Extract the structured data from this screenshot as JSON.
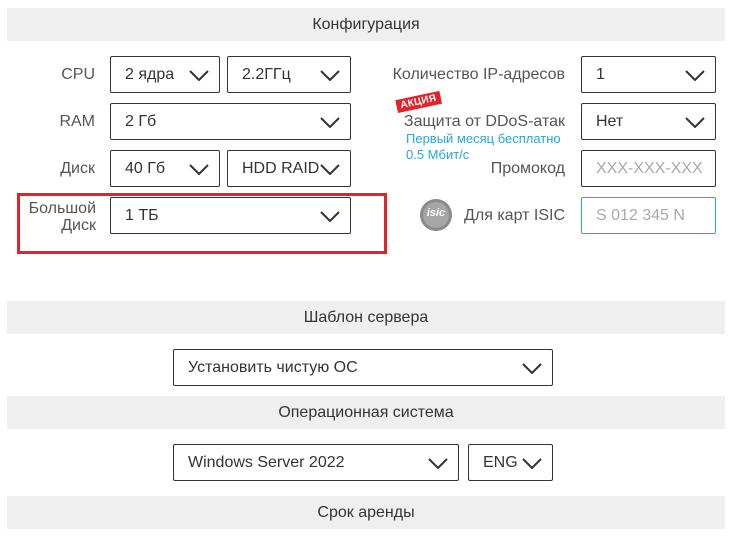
{
  "sections": {
    "config": "Конфигурация",
    "template": "Шаблон сервера",
    "os": "Операционная система",
    "rent": "Срок аренды"
  },
  "config": {
    "cpu": {
      "label": "CPU",
      "cores": "2 ядра",
      "freq": "2.2ГГц"
    },
    "ram": {
      "label": "RAM",
      "value": "2 Гб"
    },
    "disk": {
      "label": "Диск",
      "size": "40 Гб",
      "type": "HDD RAID"
    },
    "big_disk": {
      "label_line1": "Большой",
      "label_line2": "Диск",
      "value": "1 ТБ"
    },
    "ip": {
      "label": "Количество IP-адресов",
      "value": "1"
    },
    "ddos": {
      "badge": "АКЦИЯ",
      "label": "Защита от DDoS-атак",
      "promo_line1": "Первый месяц бесплатно",
      "promo_line2": "0.5 Мбит/с",
      "value": "Нет"
    },
    "promo": {
      "label": "Промокод",
      "placeholder": "XXX-XXX-XXX"
    },
    "isic": {
      "logo_text": "isic",
      "label": "Для карт ISIC",
      "placeholder": "S 012 345 N"
    }
  },
  "template": {
    "value": "Установить чистую ОС"
  },
  "os": {
    "value": "Windows Server 2022",
    "lang": "ENG"
  },
  "colors": {
    "accent_blue": "#2aa7d8",
    "highlight_red": "#e2232a",
    "badge_red": "#e2232a",
    "bar_bg": "#efefef"
  }
}
